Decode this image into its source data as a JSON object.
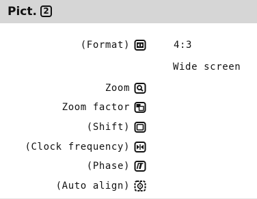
{
  "header": {
    "title": "Pict.",
    "badge": "2"
  },
  "rows": [
    {
      "label": "(Format)",
      "icon": "format-icon",
      "value": "4:3",
      "value2": "Wide screen"
    },
    {
      "label": "Zoom",
      "icon": "zoom-icon"
    },
    {
      "label": "Zoom factor",
      "icon": "zoom-factor-icon"
    },
    {
      "label": "(Shift)",
      "icon": "shift-icon"
    },
    {
      "label": "(Clock frequency)",
      "icon": "clock-frequency-icon"
    },
    {
      "label": "(Phase)",
      "icon": "phase-icon"
    },
    {
      "label": "(Auto align)",
      "icon": "auto-align-icon"
    }
  ],
  "colors": {
    "header_bg": "#d6d6d6",
    "text": "#111111",
    "background": "#ffffff"
  }
}
